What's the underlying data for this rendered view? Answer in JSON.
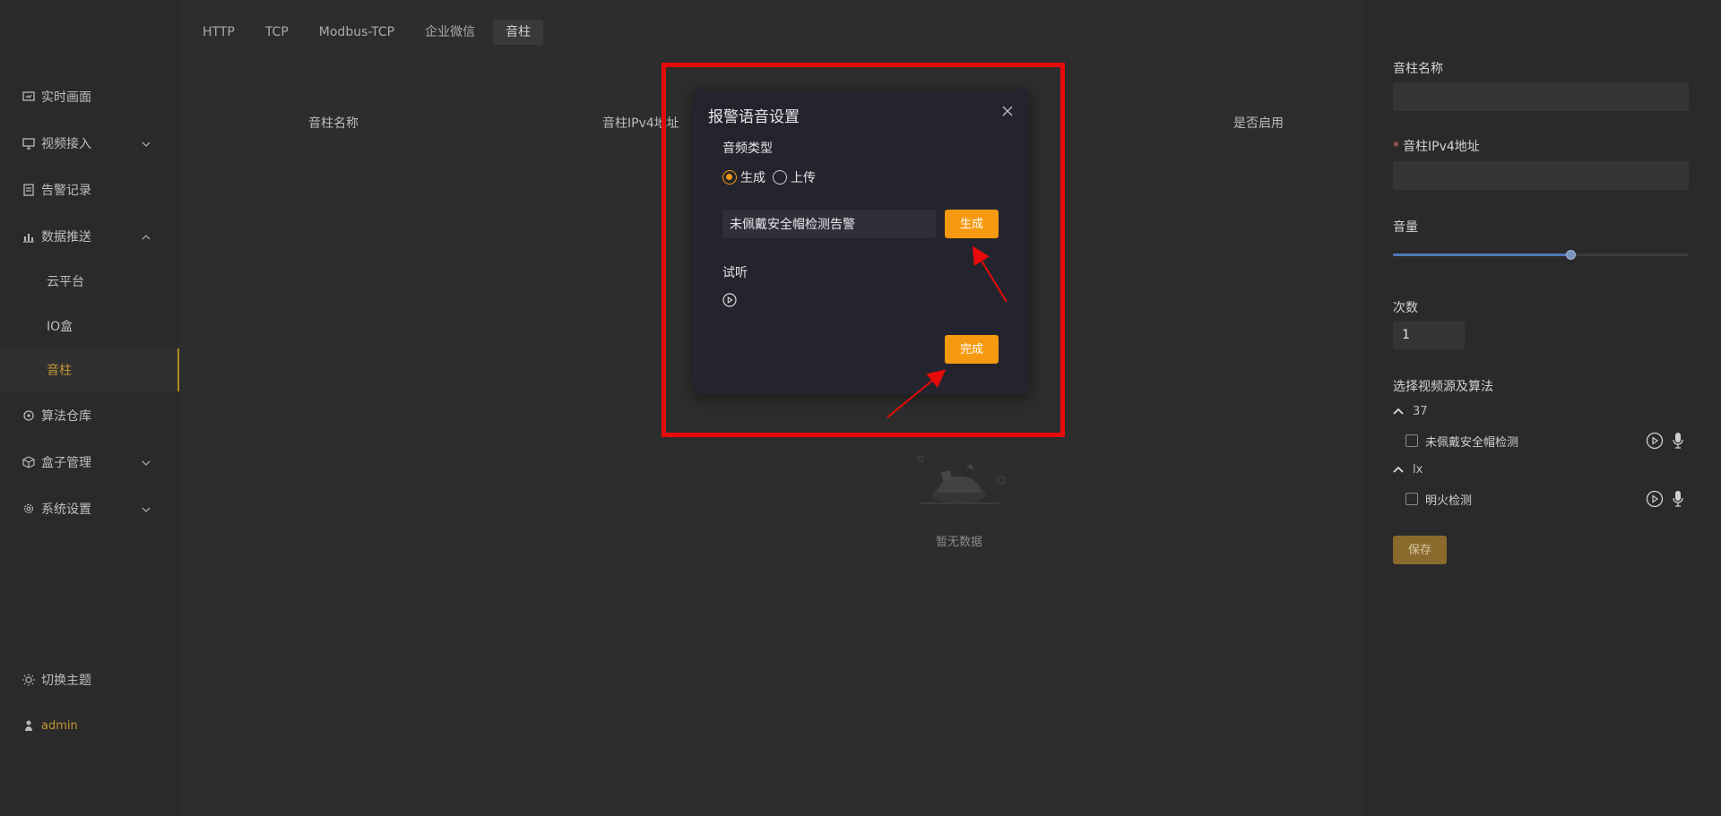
{
  "sidebar": {
    "items": [
      {
        "label": "实时画面",
        "icon": "monitor-icon"
      },
      {
        "label": "视频接入",
        "icon": "screen-icon"
      },
      {
        "label": "告警记录",
        "icon": "list-icon"
      },
      {
        "label": "数据推送",
        "icon": "chart-icon"
      },
      {
        "label": "云平台"
      },
      {
        "label": "IO盒"
      },
      {
        "label": "音柱"
      },
      {
        "label": "算法仓库",
        "icon": "algo-icon"
      },
      {
        "label": "盒子管理",
        "icon": "box-icon"
      },
      {
        "label": "系统设置",
        "icon": "gear-icon"
      }
    ],
    "theme_label": "切换主题",
    "user_label": "admin"
  },
  "main": {
    "tabs": [
      "HTTP",
      "TCP",
      "Modbus-TCP",
      "企业微信",
      "音柱"
    ],
    "columns": [
      "音柱名称",
      "音柱IPv4地址",
      "是否启用"
    ],
    "empty_text": "暂无数据"
  },
  "dialog": {
    "title": "报警语音设置",
    "audio_type_label": "音频类型",
    "radio_generate": "生成",
    "radio_upload": "上传",
    "text_value": "未佩戴安全帽检测告警",
    "generate_button": "生成",
    "preview_label": "试听",
    "done_button": "完成"
  },
  "panel": {
    "name_label": "音柱名称",
    "ipv4_label": "音柱IPv4地址",
    "volume_label": "音量",
    "volume_level": 0.6,
    "count_label": "次数",
    "count_value": "1",
    "source_label": "选择视频源及算法",
    "groups": [
      {
        "name": "37",
        "items": [
          "未佩戴安全帽检测"
        ]
      },
      {
        "name": "lx",
        "items": [
          "明火检测"
        ]
      }
    ],
    "save_button": "保存"
  },
  "colors": {
    "accent": "#f59a10",
    "highlight": "#e80a0a",
    "active_nav": "#d9a63a",
    "slider": "#4f7ab8"
  }
}
